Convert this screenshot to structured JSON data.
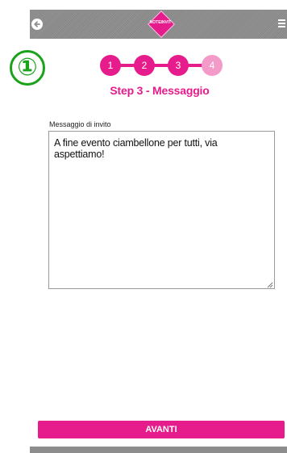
{
  "annotation": {
    "marker": "①"
  },
  "header": {
    "logo_text": "NOTEINVIT",
    "back_icon": "arrow-left-circle-icon",
    "menu_icon": "hamburger-menu-icon"
  },
  "stepper": {
    "steps": [
      {
        "label": "1",
        "state": "done"
      },
      {
        "label": "2",
        "state": "done"
      },
      {
        "label": "3",
        "state": "active"
      },
      {
        "label": "4",
        "state": "inactive"
      }
    ],
    "title": "Step 3 - Messaggio"
  },
  "form": {
    "label": "Messaggio di invito",
    "message": "A fine evento ciambellone per tutti, via aspettiamo!"
  },
  "footer": {
    "next_label": "AVANTI"
  },
  "colors": {
    "accent": "#e61c8c",
    "accent_light": "#f49ac8",
    "bar": "#8d8d8d"
  }
}
